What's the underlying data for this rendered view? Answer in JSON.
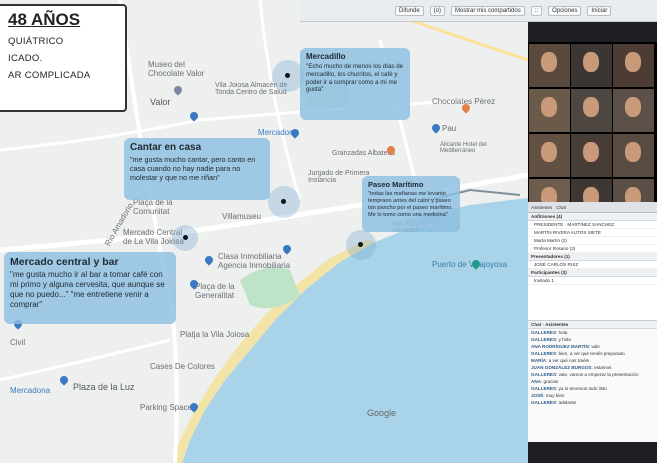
{
  "toolbar": {
    "items": [
      "Difunde",
      "(o)",
      "Mostrar mis compartidos",
      "::",
      "Opciones",
      "Iniciar"
    ]
  },
  "infobox": {
    "title": "48 AÑOS",
    "lines": [
      "QUIÁTRICO",
      "ICADO.",
      "AR COMPLICADA"
    ]
  },
  "map": {
    "labels": [
      "Museo del Chocolate Valor",
      "Vila Joiosa Almacén de Tonda Centro de Salud",
      "Valor",
      "Mercadona",
      "Chocolates Pérez",
      "Jurgado de Primera Instancia",
      "Granzadas Albateca",
      "Alicante Hotel del Mediterráneo",
      "Mercado Central de La Vila Joiosa",
      "Plaça de la Comunitat",
      "Villamuseu",
      "Clasa Inmobiliaria Agencia Inmobiliaria",
      "Plaça de la Generalitat",
      "Platja la Vila Joiosa",
      "Cases De Colores",
      "Plaza de la Luz",
      "Parking Space",
      "Puerto de Villajoyosa",
      "Pub Plaza de Valladolid",
      "Rio Amadorio",
      "Pau",
      "Civil",
      "Mercadona"
    ],
    "attribution": "Google"
  },
  "bubbles": {
    "mercadillo": {
      "title": "Mercadillo",
      "text": "\"Echo mucho de menos los días de mercadillo, los churritos, el café y poder ir a comprar como a mi me gusta\""
    },
    "cantar": {
      "title": "Cantar en casa",
      "text": "\"me gusta mucho cantar, pero canto en casa cuando no hay nadie para no molestar y que no me riñan\""
    },
    "paseo": {
      "title": "Paseo Marítimo",
      "text": "\"todas las mañanas me levanto temprano antes del calor y paseo tan pancho por el paseo marítimo. Me lo tomo como una medicina\""
    },
    "mercado": {
      "title": "Mercado central y bar",
      "text": "\"me gusta mucho ir al bar a tomar café con mi primo y alguna cervesita, que aunque se que no puedo...\" \"me entretiene venir a comprar\""
    }
  },
  "videos": {
    "names": [
      "",
      "",
      "",
      "",
      "",
      "",
      "",
      "",
      "",
      "",
      "",
      ""
    ]
  },
  "panel": {
    "header": [
      "Asistentes",
      "Chat"
    ],
    "sections": [
      {
        "title": "Anfitriones (4)",
        "rows": [
          "PRESIDENTE · MARTÍNEZ SANCHEZ",
          "MARTÍN RIVERA AUTOS SIETE",
          "Marta Martín (2)",
          "Profesor Rosario (3)"
        ]
      },
      {
        "title": "Presentadores (1)",
        "rows": [
          "JOSÉ CARLOS RUIZ"
        ]
      },
      {
        "title": "Participantes (3)",
        "rows": [
          "Invitado 1"
        ]
      }
    ],
    "chat_title": "Chat · Asistentes",
    "chat": [
      {
        "who": "GALLERES",
        "msg": "hola"
      },
      {
        "who": "GALLERES",
        "msg": "y hola"
      },
      {
        "who": "ANA RODRÍGUEZ MARTÍN",
        "msg": "vale"
      },
      {
        "who": "GALLERES",
        "msg": "bien, a ver que tenéis preparado"
      },
      {
        "who": "MARÍA",
        "msg": "a ver qué nos traéis"
      },
      {
        "who": "JUAN GONZÁLEZ BURGOS",
        "msg": "estamos"
      },
      {
        "who": "GALLERES",
        "msg": "vale, vamos a empezar la presentación"
      },
      {
        "who": "ANA",
        "msg": "gracias"
      },
      {
        "who": "GALLERES",
        "msg": "ya lo tenemos todo listo"
      },
      {
        "who": "JOSÉ",
        "msg": "muy bien"
      },
      {
        "who": "GALLERES",
        "msg": "adelante"
      }
    ]
  },
  "colors": {
    "bubble": "#8cbee1",
    "sea": "#a9d3e8",
    "land": "#eef0ef",
    "beach": "#f2e4a6",
    "park": "#bfe3c7"
  }
}
